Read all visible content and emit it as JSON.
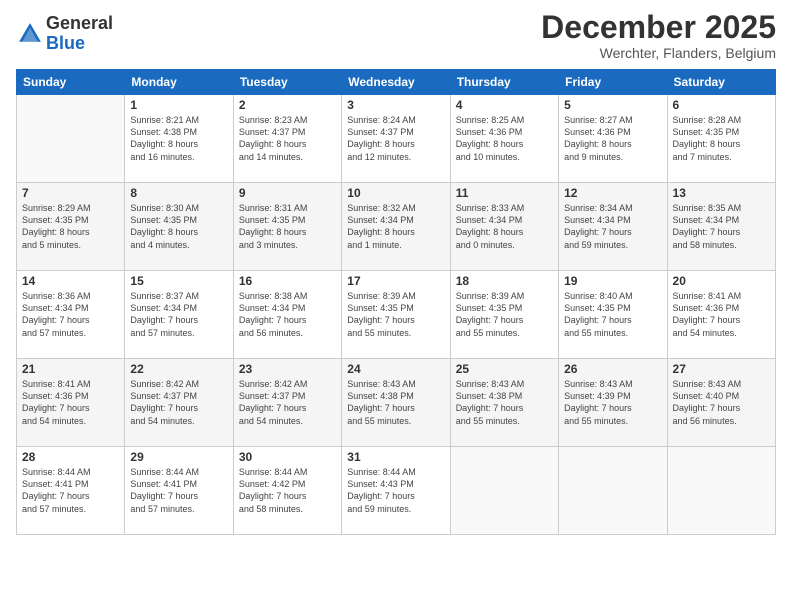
{
  "logo": {
    "general": "General",
    "blue": "Blue"
  },
  "header": {
    "month": "December 2025",
    "location": "Werchter, Flanders, Belgium"
  },
  "weekdays": [
    "Sunday",
    "Monday",
    "Tuesday",
    "Wednesday",
    "Thursday",
    "Friday",
    "Saturday"
  ],
  "weeks": [
    [
      {
        "day": "",
        "info": ""
      },
      {
        "day": "1",
        "info": "Sunrise: 8:21 AM\nSunset: 4:38 PM\nDaylight: 8 hours\nand 16 minutes."
      },
      {
        "day": "2",
        "info": "Sunrise: 8:23 AM\nSunset: 4:37 PM\nDaylight: 8 hours\nand 14 minutes."
      },
      {
        "day": "3",
        "info": "Sunrise: 8:24 AM\nSunset: 4:37 PM\nDaylight: 8 hours\nand 12 minutes."
      },
      {
        "day": "4",
        "info": "Sunrise: 8:25 AM\nSunset: 4:36 PM\nDaylight: 8 hours\nand 10 minutes."
      },
      {
        "day": "5",
        "info": "Sunrise: 8:27 AM\nSunset: 4:36 PM\nDaylight: 8 hours\nand 9 minutes."
      },
      {
        "day": "6",
        "info": "Sunrise: 8:28 AM\nSunset: 4:35 PM\nDaylight: 8 hours\nand 7 minutes."
      }
    ],
    [
      {
        "day": "7",
        "info": "Sunrise: 8:29 AM\nSunset: 4:35 PM\nDaylight: 8 hours\nand 5 minutes."
      },
      {
        "day": "8",
        "info": "Sunrise: 8:30 AM\nSunset: 4:35 PM\nDaylight: 8 hours\nand 4 minutes."
      },
      {
        "day": "9",
        "info": "Sunrise: 8:31 AM\nSunset: 4:35 PM\nDaylight: 8 hours\nand 3 minutes."
      },
      {
        "day": "10",
        "info": "Sunrise: 8:32 AM\nSunset: 4:34 PM\nDaylight: 8 hours\nand 1 minute."
      },
      {
        "day": "11",
        "info": "Sunrise: 8:33 AM\nSunset: 4:34 PM\nDaylight: 8 hours\nand 0 minutes."
      },
      {
        "day": "12",
        "info": "Sunrise: 8:34 AM\nSunset: 4:34 PM\nDaylight: 7 hours\nand 59 minutes."
      },
      {
        "day": "13",
        "info": "Sunrise: 8:35 AM\nSunset: 4:34 PM\nDaylight: 7 hours\nand 58 minutes."
      }
    ],
    [
      {
        "day": "14",
        "info": "Sunrise: 8:36 AM\nSunset: 4:34 PM\nDaylight: 7 hours\nand 57 minutes."
      },
      {
        "day": "15",
        "info": "Sunrise: 8:37 AM\nSunset: 4:34 PM\nDaylight: 7 hours\nand 57 minutes."
      },
      {
        "day": "16",
        "info": "Sunrise: 8:38 AM\nSunset: 4:34 PM\nDaylight: 7 hours\nand 56 minutes."
      },
      {
        "day": "17",
        "info": "Sunrise: 8:39 AM\nSunset: 4:35 PM\nDaylight: 7 hours\nand 55 minutes."
      },
      {
        "day": "18",
        "info": "Sunrise: 8:39 AM\nSunset: 4:35 PM\nDaylight: 7 hours\nand 55 minutes."
      },
      {
        "day": "19",
        "info": "Sunrise: 8:40 AM\nSunset: 4:35 PM\nDaylight: 7 hours\nand 55 minutes."
      },
      {
        "day": "20",
        "info": "Sunrise: 8:41 AM\nSunset: 4:36 PM\nDaylight: 7 hours\nand 54 minutes."
      }
    ],
    [
      {
        "day": "21",
        "info": "Sunrise: 8:41 AM\nSunset: 4:36 PM\nDaylight: 7 hours\nand 54 minutes."
      },
      {
        "day": "22",
        "info": "Sunrise: 8:42 AM\nSunset: 4:37 PM\nDaylight: 7 hours\nand 54 minutes."
      },
      {
        "day": "23",
        "info": "Sunrise: 8:42 AM\nSunset: 4:37 PM\nDaylight: 7 hours\nand 54 minutes."
      },
      {
        "day": "24",
        "info": "Sunrise: 8:43 AM\nSunset: 4:38 PM\nDaylight: 7 hours\nand 55 minutes."
      },
      {
        "day": "25",
        "info": "Sunrise: 8:43 AM\nSunset: 4:38 PM\nDaylight: 7 hours\nand 55 minutes."
      },
      {
        "day": "26",
        "info": "Sunrise: 8:43 AM\nSunset: 4:39 PM\nDaylight: 7 hours\nand 55 minutes."
      },
      {
        "day": "27",
        "info": "Sunrise: 8:43 AM\nSunset: 4:40 PM\nDaylight: 7 hours\nand 56 minutes."
      }
    ],
    [
      {
        "day": "28",
        "info": "Sunrise: 8:44 AM\nSunset: 4:41 PM\nDaylight: 7 hours\nand 57 minutes."
      },
      {
        "day": "29",
        "info": "Sunrise: 8:44 AM\nSunset: 4:41 PM\nDaylight: 7 hours\nand 57 minutes."
      },
      {
        "day": "30",
        "info": "Sunrise: 8:44 AM\nSunset: 4:42 PM\nDaylight: 7 hours\nand 58 minutes."
      },
      {
        "day": "31",
        "info": "Sunrise: 8:44 AM\nSunset: 4:43 PM\nDaylight: 7 hours\nand 59 minutes."
      },
      {
        "day": "",
        "info": ""
      },
      {
        "day": "",
        "info": ""
      },
      {
        "day": "",
        "info": ""
      }
    ]
  ]
}
